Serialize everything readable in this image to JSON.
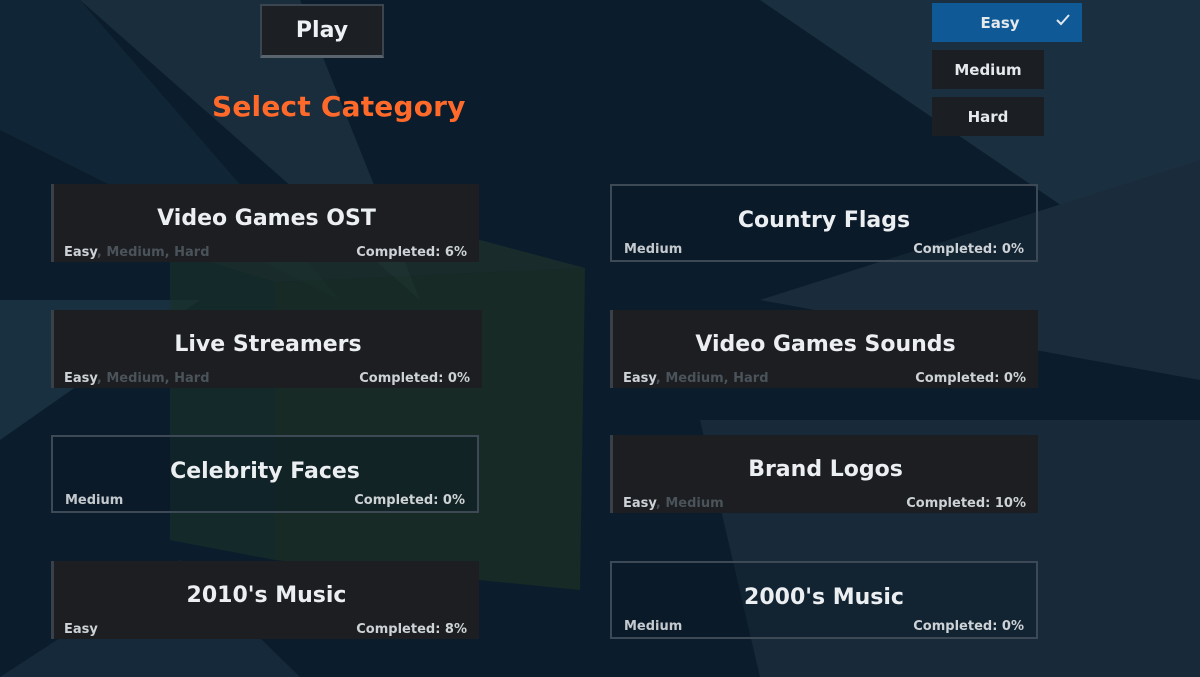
{
  "header": {
    "play_label": "Play",
    "title": "Select Category"
  },
  "difficulty": {
    "selected": "Easy",
    "options": [
      {
        "label": "Easy",
        "active": true
      },
      {
        "label": "Medium",
        "active": false
      },
      {
        "label": "Hard",
        "active": false
      }
    ]
  },
  "categories": [
    {
      "name": "Video Games OST",
      "modes": [
        "Easy",
        "Medium",
        "Hard"
      ],
      "completed": "Completed: 6%"
    },
    {
      "name": "Country Flags",
      "modes": [
        "Medium"
      ],
      "completed": "Completed: 0%"
    },
    {
      "name": "Live Streamers",
      "modes": [
        "Easy",
        "Medium",
        "Hard"
      ],
      "completed": "Completed: 0%"
    },
    {
      "name": "Video Games Sounds",
      "modes": [
        "Easy",
        "Medium",
        "Hard"
      ],
      "completed": "Completed: 0%"
    },
    {
      "name": "Celebrity Faces",
      "modes": [
        "Medium"
      ],
      "completed": "Completed: 0%"
    },
    {
      "name": "Brand Logos",
      "modes": [
        "Easy",
        "Medium"
      ],
      "completed": "Completed: 10%"
    },
    {
      "name": "2010's Music",
      "modes": [
        "Easy"
      ],
      "completed": "Completed: 8%"
    },
    {
      "name": "2000's Music",
      "modes": [
        "Medium"
      ],
      "completed": "Completed: 0%"
    }
  ],
  "colors": {
    "title": "#ff6a2b",
    "selected_difficulty": "#0f5a96",
    "background": "#0b1d2c"
  }
}
